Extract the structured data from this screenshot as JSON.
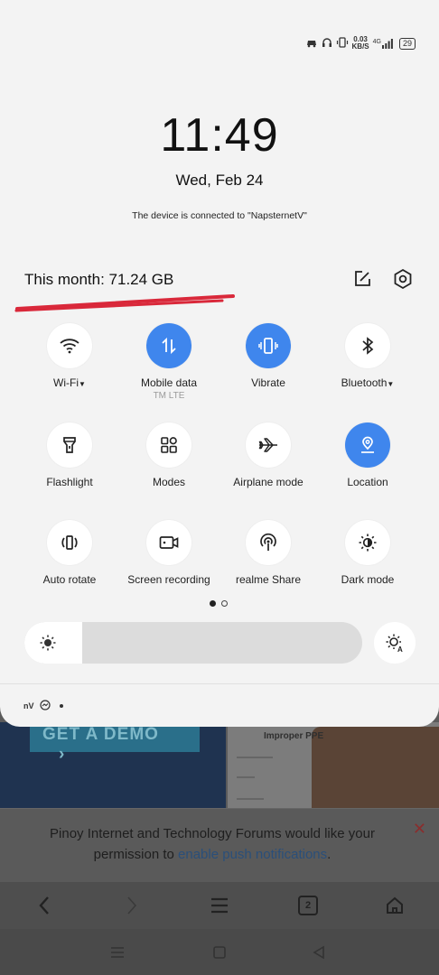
{
  "status_bar": {
    "speed": "0.03",
    "speed_unit": "KB/S",
    "network": "4G",
    "battery": "29"
  },
  "clock": "11:49",
  "date": "Wed, Feb 24",
  "vpn_message": "The device is connected to \"NapsternetV\"",
  "data_usage": "This month: 71.24 GB",
  "tiles": [
    {
      "label": "Wi-Fi",
      "dropdown": true,
      "active": false,
      "icon": "wifi-icon"
    },
    {
      "label": "Mobile data",
      "sub": "TM LTE",
      "active": true,
      "icon": "mobile-data-icon"
    },
    {
      "label": "Vibrate",
      "active": true,
      "icon": "vibrate-icon"
    },
    {
      "label": "Bluetooth",
      "dropdown": true,
      "active": false,
      "icon": "bluetooth-icon"
    },
    {
      "label": "Flashlight",
      "active": false,
      "icon": "flashlight-icon"
    },
    {
      "label": "Modes",
      "active": false,
      "icon": "modes-icon"
    },
    {
      "label": "Airplane mode",
      "active": false,
      "icon": "airplane-icon"
    },
    {
      "label": "Location",
      "active": true,
      "icon": "location-icon"
    },
    {
      "label": "Auto rotate",
      "active": false,
      "icon": "auto-rotate-icon"
    },
    {
      "label": "Screen recording",
      "active": false,
      "icon": "screen-recording-icon"
    },
    {
      "label": "realme Share",
      "active": false,
      "icon": "realme-share-icon"
    },
    {
      "label": "Dark mode",
      "active": false,
      "icon": "dark-mode-icon"
    }
  ],
  "brightness_level": 0.17,
  "notification_strip": {
    "app": "nV"
  },
  "background": {
    "demo_button": "GET A DEMO",
    "card_title": "Improper PPE",
    "push_prompt": "Pinoy Internet and Technology Forums would like your permission to",
    "push_link": "enable push notifications",
    "push_end": ".",
    "tab_count": "2"
  },
  "colors": {
    "accent": "#3f86ed",
    "underline": "#d9283a"
  }
}
